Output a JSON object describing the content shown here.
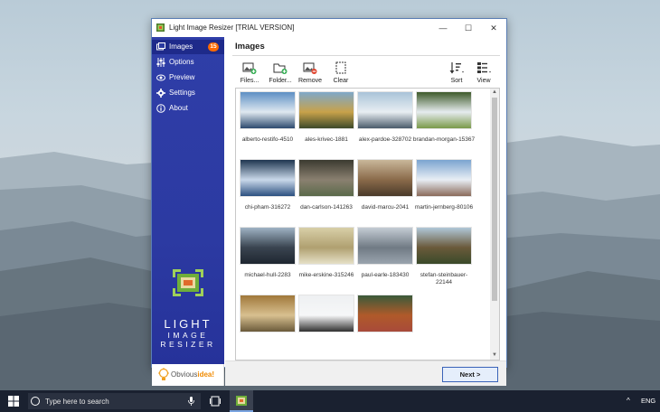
{
  "window": {
    "title": "Light Image Resizer  [TRIAL VERSION]",
    "controls": {
      "minimize": "—",
      "maximize": "☐",
      "close": "✕"
    }
  },
  "sidebar": {
    "items": [
      {
        "label": "Images",
        "icon": "images-icon",
        "badge": "15"
      },
      {
        "label": "Options",
        "icon": "sliders-icon"
      },
      {
        "label": "Preview",
        "icon": "eye-icon"
      },
      {
        "label": "Settings",
        "icon": "gear-icon"
      },
      {
        "label": "About",
        "icon": "info-icon"
      }
    ],
    "brand": {
      "line1": "LIGHT",
      "line2": "IMAGE",
      "line3": "RESIZER"
    },
    "sponsor": {
      "prefix": "Obvious",
      "suffix": "idea!"
    }
  },
  "main": {
    "heading": "Images",
    "toolbar": {
      "files": "Files...",
      "folder": "Folder...",
      "remove": "Remove",
      "clear": "Clear",
      "sort": "Sort",
      "view": "View"
    },
    "thumbnails": [
      {
        "caption": "alberto-restifo-4510",
        "colors": [
          "#5d8fc4",
          "#dfe8f0",
          "#2c4a6e"
        ]
      },
      {
        "caption": "ales-krivec-1881",
        "colors": [
          "#7fa8c9",
          "#c8a24a",
          "#3d4a2a"
        ]
      },
      {
        "caption": "alex-pardoe-328702",
        "colors": [
          "#a9c3d8",
          "#e8eef2",
          "#4a5b6a"
        ]
      },
      {
        "caption": "brandan-morgan-15367",
        "colors": [
          "#3e5a2a",
          "#e6ecef",
          "#7a9a4a"
        ]
      },
      {
        "caption": "chi-pham-316272",
        "colors": [
          "#1e3550",
          "#c9d8ea",
          "#2c5080"
        ]
      },
      {
        "caption": "dan-carlson-141263",
        "colors": [
          "#3b3a30",
          "#8a8070",
          "#5a6a4a"
        ]
      },
      {
        "caption": "david-marcu-2041",
        "colors": [
          "#c9b79a",
          "#8a6a4a",
          "#4a3a2a"
        ]
      },
      {
        "caption": "martin-jernberg-80106",
        "colors": [
          "#7aa4d0",
          "#e8eef4",
          "#8a6a5a"
        ]
      },
      {
        "caption": "michael-hull-2283",
        "colors": [
          "#9fb3c4",
          "#3a4450",
          "#1e2630"
        ]
      },
      {
        "caption": "mike-erskine-315246",
        "colors": [
          "#d8cfa8",
          "#b0a070",
          "#e6e0c6"
        ]
      },
      {
        "caption": "paul-earle-183430",
        "colors": [
          "#c4ccd4",
          "#707a84",
          "#9aa4ae"
        ]
      },
      {
        "caption": "stefan-steinbauer-22144",
        "colors": [
          "#b0c8d8",
          "#6a5a3a",
          "#3a4a2a"
        ]
      },
      {
        "caption": "",
        "colors": [
          "#a0783a",
          "#d8c090",
          "#6a5a3a"
        ]
      },
      {
        "caption": "",
        "colors": [
          "#eef0f2",
          "#f6f7f8",
          "#303030"
        ]
      },
      {
        "caption": "",
        "colors": [
          "#3a5a3a",
          "#b05a2a",
          "#a84a3a"
        ]
      }
    ],
    "next_button": "Next >"
  },
  "taskbar": {
    "search_placeholder": "Type here to search",
    "tray_chevron": "^",
    "language": "ENG"
  }
}
